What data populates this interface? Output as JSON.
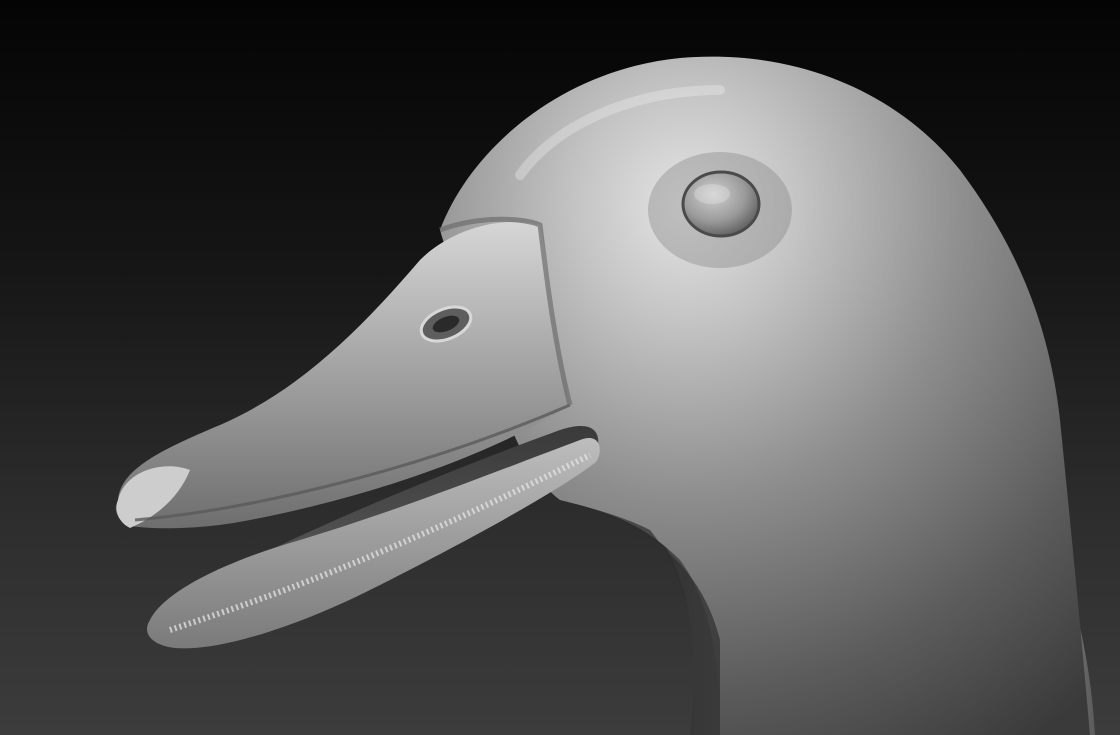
{
  "scene": {
    "subject": "duck-head-sculpt",
    "colors": {
      "background_top": "#050505",
      "background_bottom": "#3b3b3b",
      "material_light": "#cfcfcf",
      "material_mid": "#8c8c8c",
      "material_dark": "#3e3e3e",
      "eye": "#9a9a9a"
    }
  }
}
